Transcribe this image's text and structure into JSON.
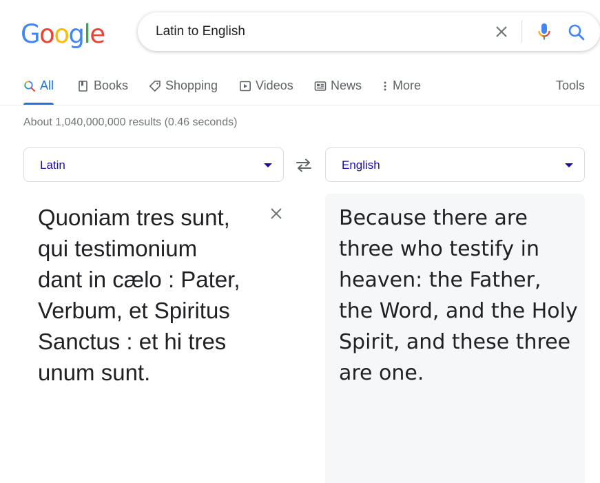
{
  "logo": {
    "letters": [
      "G",
      "o",
      "o",
      "g",
      "l",
      "e"
    ],
    "colors": [
      "#4285F4",
      "#EA4335",
      "#FBBC05",
      "#4285F4",
      "#34A853",
      "#EA4335"
    ]
  },
  "search": {
    "query": "Latin to English"
  },
  "tabs": [
    {
      "label": "All",
      "icon": "search-icon",
      "active": true
    },
    {
      "label": "Books",
      "icon": "book-icon"
    },
    {
      "label": "Shopping",
      "icon": "tag-icon"
    },
    {
      "label": "Videos",
      "icon": "play-icon"
    },
    {
      "label": "News",
      "icon": "news-icon"
    },
    {
      "label": "More",
      "icon": "more-vert-icon"
    }
  ],
  "tools_label": "Tools",
  "stats": "About 1,040,000,000 results (0.46 seconds)",
  "translate": {
    "source_lang": "Latin",
    "target_lang": "English",
    "source_text": "Quoniam tres sunt, qui testimonium dant in cælo : Pater, Verbum, et Spiritus Sanctus : et hi tres unum sunt.",
    "target_text": "Because there are three who testify in heaven: the Father, the Word, and the Holy Spirit, and these three are one."
  },
  "colors": {
    "accent": "#1a73e8",
    "link": "#1a0dab",
    "muted": "#70757a"
  }
}
